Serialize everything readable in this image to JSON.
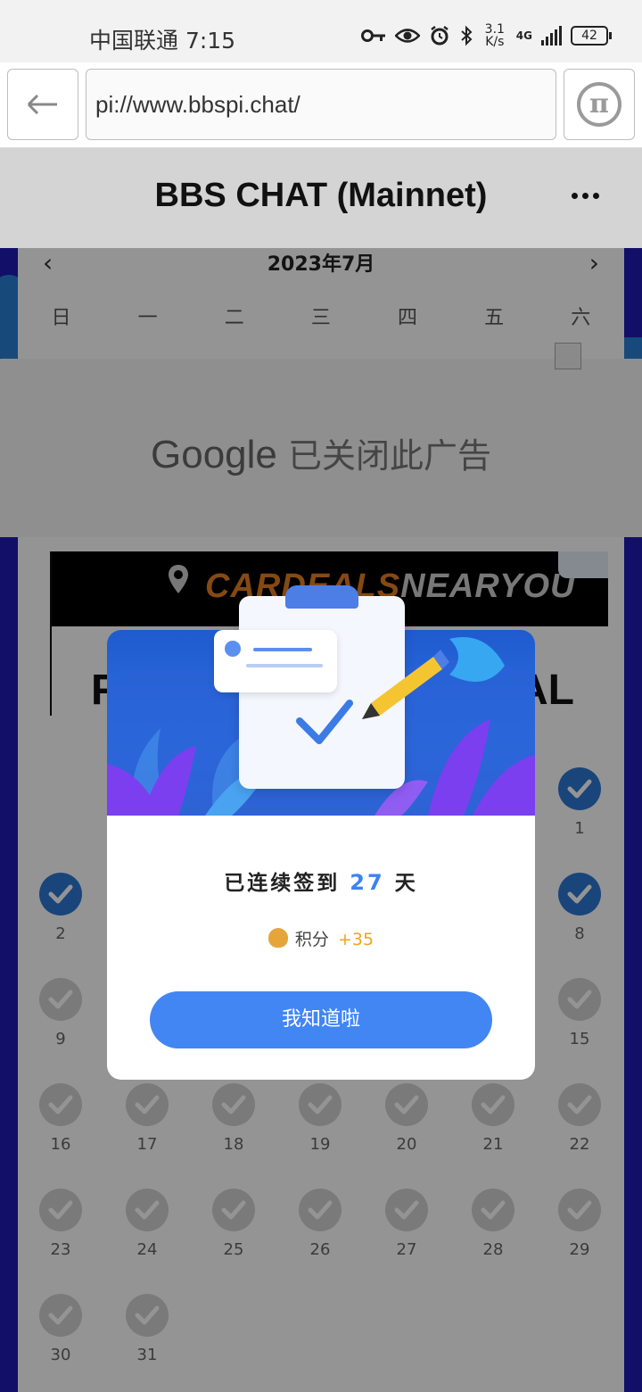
{
  "status_bar": {
    "carrier_time": "中国联通 7:15",
    "speed_top": "3.1",
    "speed_bottom": "K/s",
    "network": "4G",
    "battery": "42"
  },
  "browser": {
    "url": "pi://www.bbspi.chat/"
  },
  "app": {
    "title": "BBS CHAT (Mainnet)"
  },
  "calendar": {
    "month": "2023年7月",
    "prev": "‹",
    "next": "›",
    "weekdays": [
      "日",
      "一",
      "二",
      "三",
      "四",
      "五",
      "六"
    ],
    "days": [
      {
        "n": "1",
        "checked": true
      },
      {
        "n": "2",
        "checked": true
      },
      {
        "n": "8",
        "checked": true
      },
      {
        "n": "9",
        "checked": false
      },
      {
        "n": "15",
        "checked": false
      },
      {
        "n": "16",
        "checked": false
      },
      {
        "n": "17",
        "checked": false
      },
      {
        "n": "18",
        "checked": false
      },
      {
        "n": "19",
        "checked": false
      },
      {
        "n": "20",
        "checked": false
      },
      {
        "n": "21",
        "checked": false
      },
      {
        "n": "22",
        "checked": false
      },
      {
        "n": "23",
        "checked": false
      },
      {
        "n": "24",
        "checked": false
      },
      {
        "n": "25",
        "checked": false
      },
      {
        "n": "26",
        "checked": false
      },
      {
        "n": "27",
        "checked": false
      },
      {
        "n": "28",
        "checked": false
      },
      {
        "n": "29",
        "checked": false
      },
      {
        "n": "30",
        "checked": false
      },
      {
        "n": "31",
        "checked": false
      }
    ]
  },
  "ad": {
    "google_text": "Google",
    "closed_text": "已关闭此广告",
    "brand_a": "CARDEALS",
    "brand_b": "NEARYOU",
    "big_left": "F",
    "big_right": "AL"
  },
  "modal": {
    "streak_prefix": "已连续签到",
    "streak_days": "27",
    "streak_suffix": "天",
    "points_label": "积分",
    "points_value": "+35",
    "ok_label": "我知道啦"
  },
  "colors": {
    "accent": "#4286f4",
    "check_blue": "#2c78d4",
    "points_gold": "#f0a41c",
    "page_bg": "#1e1bb3"
  }
}
